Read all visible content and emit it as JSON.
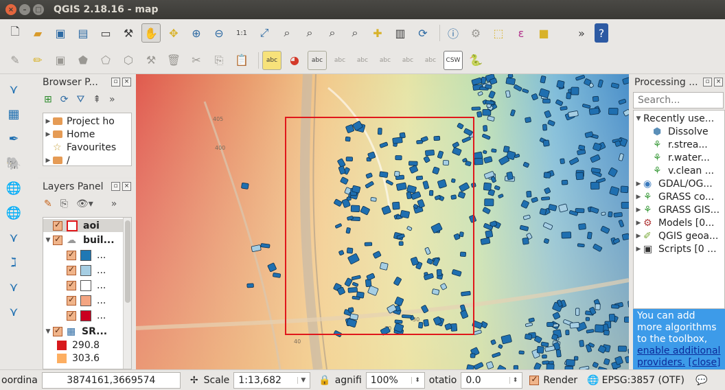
{
  "window": {
    "title": "QGIS 2.18.16 - map"
  },
  "toolbar": {
    "more": "»",
    "label_tool": "abc",
    "csw": "CSW",
    "help": "?"
  },
  "browser": {
    "title": "Browser P...",
    "items": [
      {
        "label": "Project ho"
      },
      {
        "label": "Home"
      },
      {
        "label": "Favourites"
      },
      {
        "label": "/"
      }
    ]
  },
  "layers": {
    "title": "Layers Panel",
    "aoi": "aoi",
    "buildings": "buil...",
    "class_label": "...",
    "class_colors": [
      "#1f78b4",
      "#a6cee3",
      "#ffffff",
      "#f4a582",
      "#ca0020"
    ],
    "srtm": "SR...",
    "legend": [
      {
        "value": "290.8",
        "color": "#d7191c"
      },
      {
        "value": "303.6",
        "color": "#fdae61"
      }
    ]
  },
  "processing": {
    "title": "Processing ...",
    "search_placeholder": "Search...",
    "recent": "Recently use...",
    "recent_items": [
      "Dissolve",
      "r.strea...",
      "r.water...",
      "v.clean ..."
    ],
    "providers": [
      "GDAL/OG...",
      "GRASS co...",
      "GRASS GIS...",
      "Models [0...",
      "QGIS geoa...",
      "Scripts [0 ..."
    ]
  },
  "banner": {
    "text": "You can add more algorithms to the toolbox, ",
    "link": "enable additional providers.",
    "close": "[close]"
  },
  "map": {
    "road_labels": [
      "405",
      "400",
      "30",
      "30",
      "40"
    ],
    "aoi_color": "#e0171b"
  },
  "status": {
    "coord_label": "oordina",
    "coord_value": "3874161,3669574",
    "scale_label": "Scale",
    "scale_value": "1:13,682",
    "magnifier_label": "agnifi",
    "magnifier_value": "100%",
    "rotation_label": "otatio",
    "rotation_value": "0.0",
    "render_label": "Render",
    "crs": "EPSG:3857 (OTF)"
  }
}
